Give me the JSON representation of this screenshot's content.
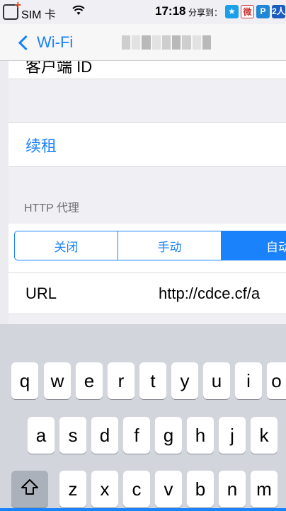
{
  "status_bar": {
    "carrier": "SIM 卡",
    "time": "17:18",
    "share_label": "分享到：",
    "share_targets": [
      "QQ空间",
      "微博",
      "pp",
      "人人"
    ],
    "renren_glyph": "2人"
  },
  "nav": {
    "back_label": "Wi-Fi"
  },
  "settings": {
    "client_id_label": "客户端 ID",
    "renew_label": "续租",
    "http_proxy_header": "HTTP 代理",
    "proxy_modes": [
      "关闭",
      "手动",
      "自动"
    ],
    "proxy_mode_selected": "自动",
    "url_label": "URL",
    "url_value": "http://cdce.cf/a"
  },
  "keyboard": {
    "row1": [
      "q",
      "w",
      "e",
      "r",
      "t",
      "y",
      "u",
      "i",
      "o"
    ],
    "row2": [
      "a",
      "s",
      "d",
      "f",
      "g",
      "h",
      "j",
      "k"
    ],
    "row3": [
      "z",
      "x",
      "c",
      "v",
      "b",
      "n",
      "m"
    ],
    "shift_icon": "shift-icon"
  },
  "colors": {
    "accent": "#1a82fb",
    "grouped_background": "#efeff4",
    "keyboard_background": "#d2d5db"
  }
}
